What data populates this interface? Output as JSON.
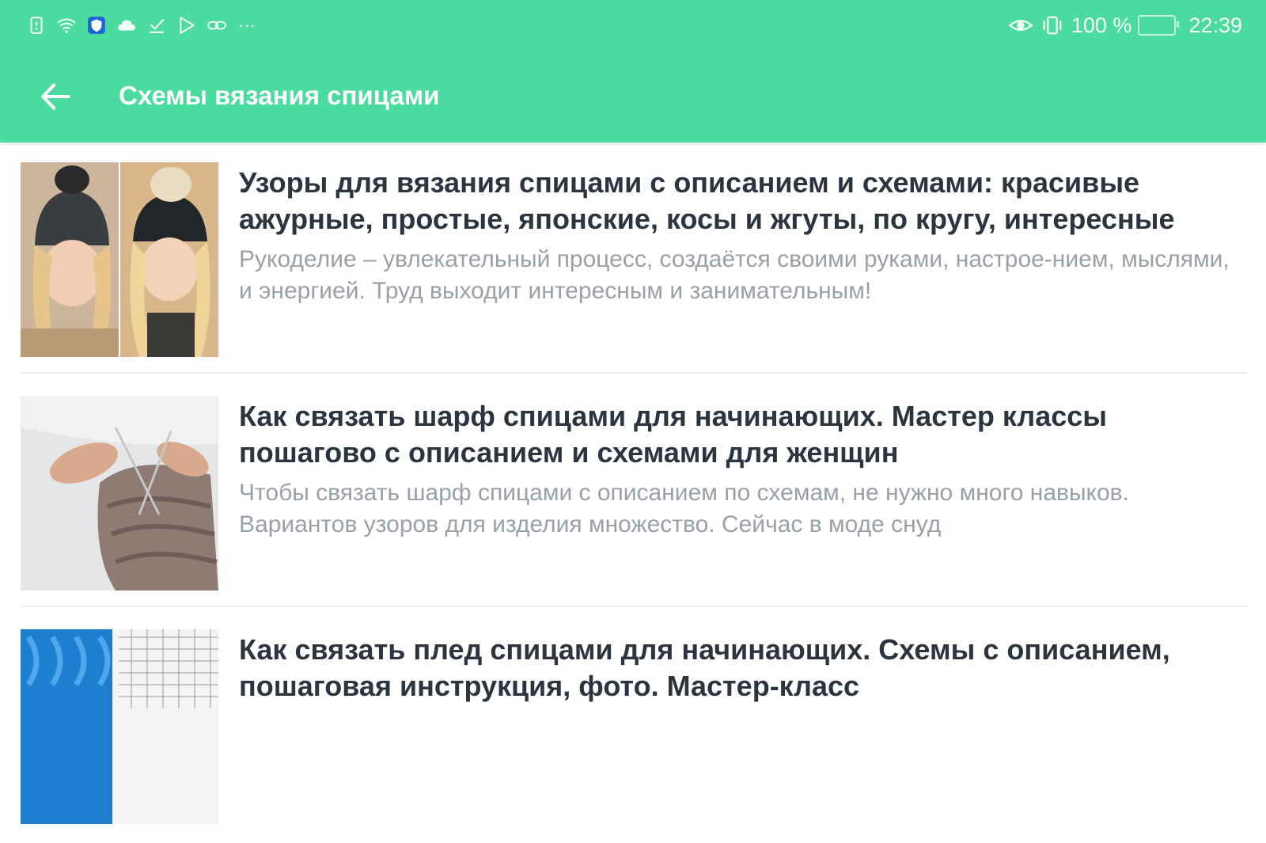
{
  "status_bar": {
    "left_icons": [
      "sim-alert-icon",
      "wifi-icon",
      "shield-app-icon",
      "cloud-icon",
      "download-done-icon",
      "play-store-icon",
      "link-icon",
      "more-dots-icon"
    ],
    "more_indicator": "···",
    "right_icons": [
      "eye-comfort-icon",
      "vibrate-icon",
      "battery-icon"
    ],
    "battery_percent": "100 %",
    "time": "22:39"
  },
  "app_bar": {
    "back_icon": "arrow-left-icon",
    "title": "Схемы вязания спицами"
  },
  "colors": {
    "accent": "#4cdb9f",
    "title_text": "#2c3440",
    "desc_text": "#9aa0a6",
    "divider": "#eeeeee"
  },
  "articles": [
    {
      "title": "Узоры для вязания спицами с описанием и схемами: красивые ажурные, простые, японские, косы и жгуты, по кругу, интересные",
      "description": "Рукоделие – увлекательный процесс, создаётся своими руками, настрое-нием, мыслями, и энергией. Труд выходит интересным и занимательным!"
    },
    {
      "title": "Как связать шарф спицами для начинающих. Мастер классы пошагово с описанием и схемами для женщин",
      "description": "Чтобы связать шарф спицами с описанием по схемам, не нужно много навыков. Вариантов узоров для изделия множество. Сейчас в моде снуд"
    },
    {
      "title": "Как связать плед спицами для начинающих. Схемы с описанием, пошаговая инструкция, фото. Мастер-класс",
      "description": ""
    }
  ]
}
